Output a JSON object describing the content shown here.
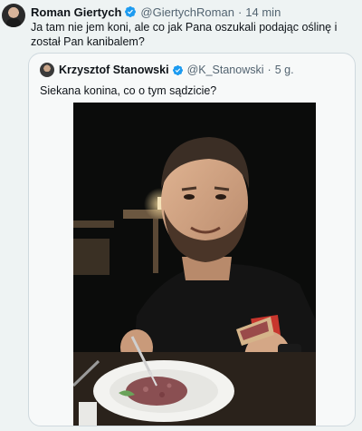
{
  "tweet": {
    "author_name": "Roman Giertych",
    "author_handle": "@GiertychRoman",
    "separator": "·",
    "time": "14 min",
    "text": "Ja tam nie jem koni, ale co jak Pana oszukali podając oślinę i został Pan kanibalem?"
  },
  "quoted": {
    "author_name": "Krzysztof Stanowski",
    "author_handle": "@K_Stanowski",
    "separator": "·",
    "time": "5 g.",
    "text": "Siekana konina, co o tym sądzicie?"
  },
  "colors": {
    "verified_badge": "#1d9bf0",
    "muted_text": "#536471",
    "border": "#cfd9de"
  },
  "icons": {
    "verified": "verified-badge-icon"
  }
}
